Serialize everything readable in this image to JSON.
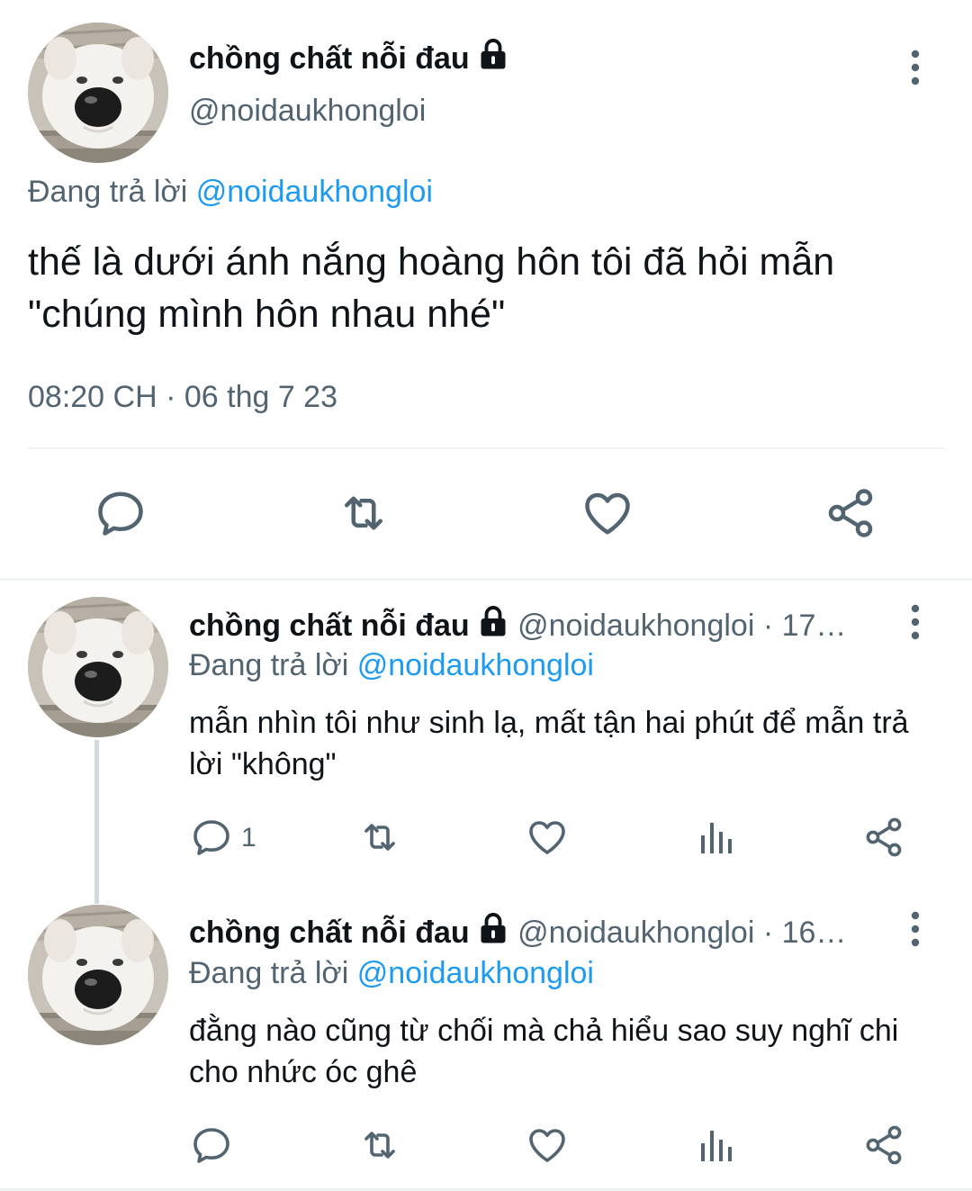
{
  "main_tweet": {
    "display_name": "chồng chất nỗi đau",
    "handle": "@noidaukhongloi",
    "replying_prefix": "Đang trả lời",
    "replying_to": "@noidaukhongloi",
    "text": "thế là dưới ánh nắng hoàng hôn tôi đã hỏi mẫn \"chúng mình hôn nhau nhé\"",
    "timestamp": "08:20 CH · 06 thg 7 23",
    "icons": [
      "reply-icon",
      "retweet-icon",
      "like-icon",
      "share-icon",
      "more-icon",
      "lock-icon"
    ]
  },
  "replies": [
    {
      "display_name": "chồng chất nỗi đau",
      "meta": "@noidaukhongloi · 17…",
      "replying_prefix": "Đang trả lời",
      "replying_to": "@noidaukhongloi",
      "text": "mẫn nhìn tôi như sinh lạ, mất tận hai phút để mẫn trả lời \"không\"",
      "reply_count": "1"
    },
    {
      "display_name": "chồng chất nỗi đau",
      "meta": "@noidaukhongloi · 16…",
      "replying_prefix": "Đang trả lời",
      "replying_to": "@noidaukhongloi",
      "text": "đằng nào cũng từ chối mà chả hiểu sao suy nghĩ chi cho nhức óc ghê",
      "reply_count": ""
    }
  ],
  "colors": {
    "text": "#0f1419",
    "secondary": "#536471",
    "accent": "#1d9bf0",
    "divider": "#eff3f4"
  }
}
